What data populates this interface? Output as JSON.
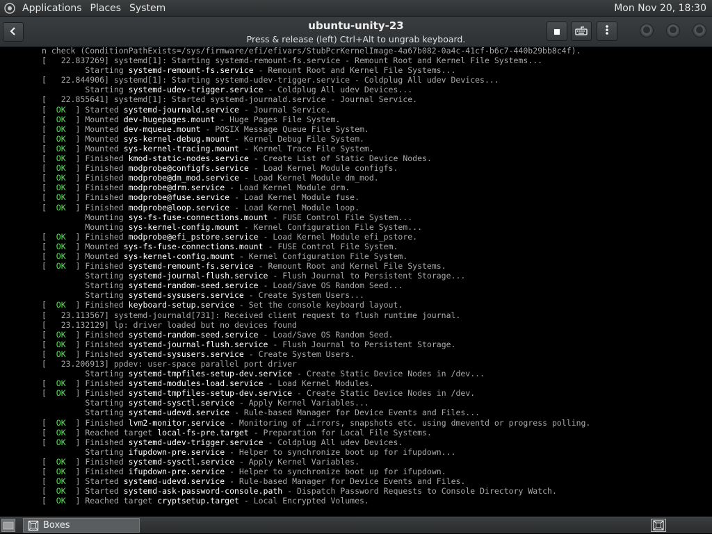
{
  "top_panel": {
    "menus": [
      "Applications",
      "Places",
      "System"
    ],
    "clock": "Mon Nov 20, 18:30"
  },
  "header": {
    "title": "ubuntu-unity-23",
    "subtitle": "Press & release (left) Ctrl+Alt to ungrab keyboard."
  },
  "icons": {
    "back": "back-arrow-icon",
    "stop": "stop-icon",
    "keyboard": "keyboard-icon",
    "menu": "vertical-ellipsis-icon"
  },
  "colors": {
    "ok_status": "#55dd55",
    "console_text": "#aaaaaa",
    "highlight_text": "#ffffff"
  },
  "console": {
    "lines": [
      {
        "text": "n check (ConditionPathExists=/sys/firmware/efi/efivars/StubPcrKernelImage-4a67b082-0a4c-41cf-b6c7-440b29bb8c4f)."
      },
      {
        "text": "[   22.837269] systemd[1]: Starting systemd-remount-fs.service - Remount Root and Kernel File Systems..."
      },
      {
        "indent": true,
        "verb": "Starting",
        "unit": "systemd-remount-fs.service",
        "desc": " - Remount Root and Kernel File Systems..."
      },
      {
        "text": "[   22.844906] systemd[1]: Starting systemd-udev-trigger.service - Coldplug All udev Devices..."
      },
      {
        "indent": true,
        "verb": "Starting",
        "unit": "systemd-udev-trigger.service",
        "desc": " - Coldplug All udev Devices..."
      },
      {
        "text": "[   22.855641] systemd[1]: Started systemd-journald.service - Journal Service."
      },
      {
        "status": "OK",
        "verb": "Started",
        "unit": "systemd-journald.service",
        "desc": " - Journal Service."
      },
      {
        "status": "OK",
        "verb": "Mounted",
        "unit": "dev-hugepages.mount",
        "desc": " - Huge Pages File System."
      },
      {
        "status": "OK",
        "verb": "Mounted",
        "unit": "dev-mqueue.mount",
        "desc": " - POSIX Message Queue File System."
      },
      {
        "status": "OK",
        "verb": "Mounted",
        "unit": "sys-kernel-debug.mount",
        "desc": " - Kernel Debug File System."
      },
      {
        "status": "OK",
        "verb": "Mounted",
        "unit": "sys-kernel-tracing.mount",
        "desc": " - Kernel Trace File System."
      },
      {
        "status": "OK",
        "verb": "Finished",
        "unit": "kmod-static-nodes.service",
        "desc": " - Create List of Static Device Nodes."
      },
      {
        "status": "OK",
        "verb": "Finished",
        "unit": "modprobe@configfs.service",
        "desc": " - Load Kernel Module configfs."
      },
      {
        "status": "OK",
        "verb": "Finished",
        "unit": "modprobe@dm_mod.service",
        "desc": " - Load Kernel Module dm_mod."
      },
      {
        "status": "OK",
        "verb": "Finished",
        "unit": "modprobe@drm.service",
        "desc": " - Load Kernel Module drm."
      },
      {
        "status": "OK",
        "verb": "Finished",
        "unit": "modprobe@fuse.service",
        "desc": " - Load Kernel Module fuse."
      },
      {
        "status": "OK",
        "verb": "Finished",
        "unit": "modprobe@loop.service",
        "desc": " - Load Kernel Module loop."
      },
      {
        "indent": true,
        "verb": "Mounting",
        "unit": "sys-fs-fuse-connections.mount",
        "desc": " - FUSE Control File System..."
      },
      {
        "indent": true,
        "verb": "Mounting",
        "unit": "sys-kernel-config.mount",
        "desc": " - Kernel Configuration File System..."
      },
      {
        "status": "OK",
        "verb": "Finished",
        "unit": "modprobe@efi_pstore.service",
        "desc": " - Load Kernel Module efi_pstore."
      },
      {
        "status": "OK",
        "verb": "Mounted",
        "unit": "sys-fs-fuse-connections.mount",
        "desc": " - FUSE Control File System."
      },
      {
        "status": "OK",
        "verb": "Mounted",
        "unit": "sys-kernel-config.mount",
        "desc": " - Kernel Configuration File System."
      },
      {
        "status": "OK",
        "verb": "Finished",
        "unit": "systemd-remount-fs.service",
        "desc": " - Remount Root and Kernel File Systems."
      },
      {
        "indent": true,
        "verb": "Starting",
        "unit": "systemd-journal-flush.service",
        "desc": " - Flush Journal to Persistent Storage..."
      },
      {
        "indent": true,
        "verb": "Starting",
        "unit": "systemd-random-seed.service",
        "desc": " - Load/Save OS Random Seed..."
      },
      {
        "indent": true,
        "verb": "Starting",
        "unit": "systemd-sysusers.service",
        "desc": " - Create System Users..."
      },
      {
        "status": "OK",
        "verb": "Finished",
        "unit": "keyboard-setup.service",
        "desc": " - Set the console keyboard layout."
      },
      {
        "text": "[   23.113567] systemd-journald[731]: Received client request to flush runtime journal."
      },
      {
        "text": "[   23.132129] lp: driver loaded but no devices found"
      },
      {
        "status": "OK",
        "verb": "Finished",
        "unit": "systemd-random-seed.service",
        "desc": " - Load/Save OS Random Seed."
      },
      {
        "status": "OK",
        "verb": "Finished",
        "unit": "systemd-journal-flush.service",
        "desc": " - Flush Journal to Persistent Storage."
      },
      {
        "status": "OK",
        "verb": "Finished",
        "unit": "systemd-sysusers.service",
        "desc": " - Create System Users."
      },
      {
        "text": "[   23.206913] ppdev: user-space parallel port driver"
      },
      {
        "indent": true,
        "verb": "Starting",
        "unit": "systemd-tmpfiles-setup-dev.service",
        "desc": " - Create Static Device Nodes in /dev..."
      },
      {
        "status": "OK",
        "verb": "Finished",
        "unit": "systemd-modules-load.service",
        "desc": " - Load Kernel Modules."
      },
      {
        "status": "OK",
        "verb": "Finished",
        "unit": "systemd-tmpfiles-setup-dev.service",
        "desc": " - Create Static Device Nodes in /dev."
      },
      {
        "indent": true,
        "verb": "Starting",
        "unit": "systemd-sysctl.service",
        "desc": " - Apply Kernel Variables..."
      },
      {
        "indent": true,
        "verb": "Starting",
        "unit": "systemd-udevd.service",
        "desc": " - Rule-based Manager for Device Events and Files..."
      },
      {
        "status": "OK",
        "verb": "Finished",
        "unit": "lvm2-monitor.service",
        "desc": " - Monitoring of …irrors, snapshots etc. using dmeventd or progress polling."
      },
      {
        "status": "OK",
        "verb": "Reached target",
        "unit": "local-fs-pre.target",
        "desc": " - Preparation for Local File Systems."
      },
      {
        "status": "OK",
        "verb": "Finished",
        "unit": "systemd-udev-trigger.service",
        "desc": " - Coldplug All udev Devices."
      },
      {
        "indent": true,
        "verb": "Starting",
        "unit": "ifupdown-pre.service",
        "desc": " - Helper to synchronize boot up for ifupdown..."
      },
      {
        "status": "OK",
        "verb": "Finished",
        "unit": "systemd-sysctl.service",
        "desc": " - Apply Kernel Variables."
      },
      {
        "status": "OK",
        "verb": "Finished",
        "unit": "ifupdown-pre.service",
        "desc": " - Helper to synchronize boot up for ifupdown."
      },
      {
        "status": "OK",
        "verb": "Started",
        "unit": "systemd-udevd.service",
        "desc": " - Rule-based Manager for Device Events and Files."
      },
      {
        "status": "OK",
        "verb": "Started",
        "unit": "systemd-ask-password-console.path",
        "desc": " - Dispatch Password Requests to Console Directory Watch."
      },
      {
        "status": "OK",
        "verb": "Reached target",
        "unit": "cryptsetup.target",
        "desc": " - Local Encrypted Volumes."
      }
    ]
  },
  "taskbar": {
    "task_label": "Boxes"
  }
}
